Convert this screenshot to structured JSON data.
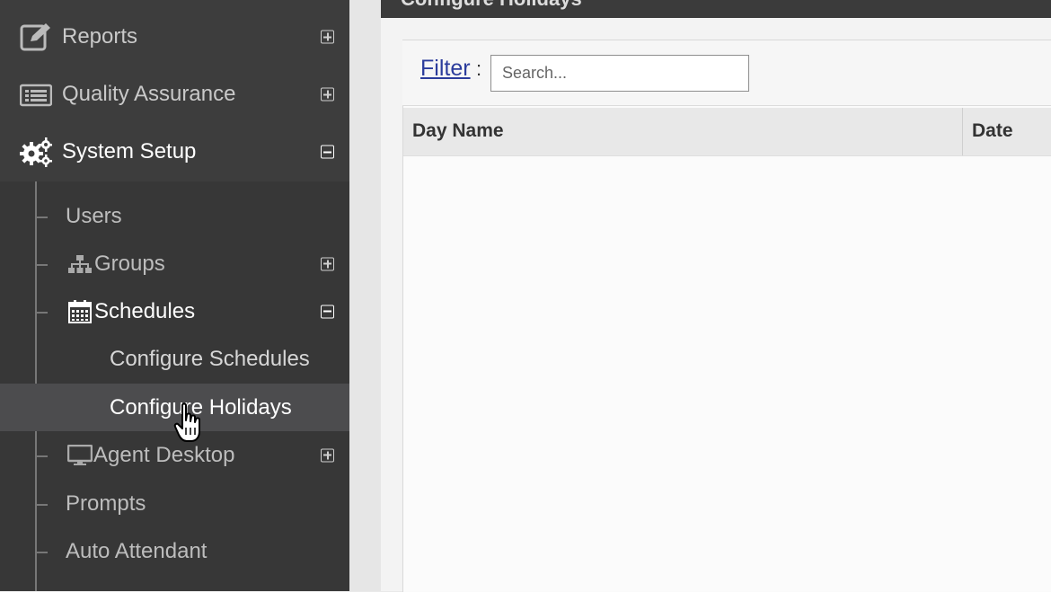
{
  "sidebar": {
    "items": [
      {
        "label": "Reports",
        "icon": "edit-icon",
        "toggle": "expand"
      },
      {
        "label": "Quality Assurance",
        "icon": "list-icon",
        "toggle": "expand"
      },
      {
        "label": "System Setup",
        "icon": "gears-icon",
        "toggle": "collapse"
      }
    ],
    "sub_items": {
      "users": "Users",
      "groups": "Groups",
      "schedules": "Schedules",
      "configure_schedules": "Configure Schedules",
      "configure_holidays": "Configure Holidays",
      "agent_desktop": "Agent Desktop",
      "prompts": "Prompts",
      "auto_attendant": "Auto Attendant"
    }
  },
  "main": {
    "title": "Configure Holidays",
    "filter": {
      "label": "Filter",
      "colon": ":",
      "placeholder": "Search...",
      "value": ""
    },
    "table": {
      "columns": [
        "Day Name",
        "Date"
      ],
      "rows": []
    }
  },
  "colors": {
    "sidebar_bg": "#3d3d3d",
    "selected_bg": "#4c4c4e",
    "link": "#2b3c9c"
  }
}
